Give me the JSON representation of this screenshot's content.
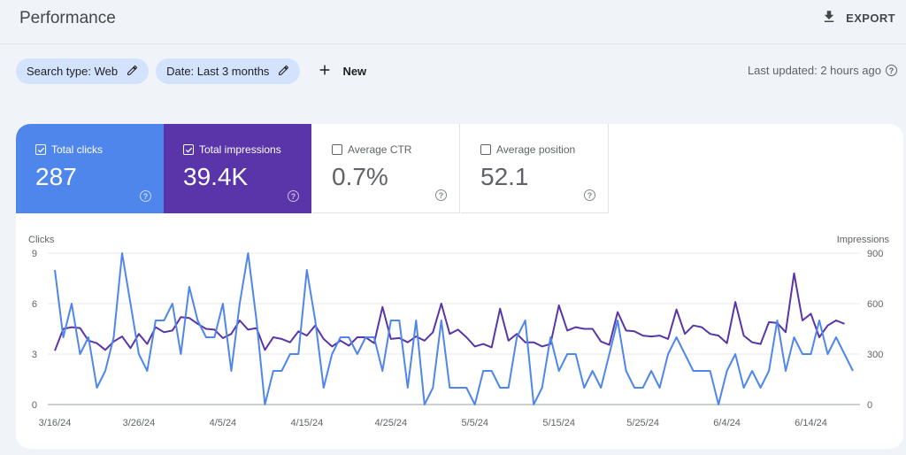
{
  "header": {
    "title": "Performance",
    "export_label": "EXPORT"
  },
  "filters": {
    "search_type": "Search type: Web",
    "date": "Date: Last 3 months",
    "new_label": "New"
  },
  "last_updated": "Last updated: 2 hours ago",
  "metrics": [
    {
      "label": "Total clicks",
      "value": "287",
      "checked": true,
      "color": "#4f86ec"
    },
    {
      "label": "Total impressions",
      "value": "39.4K",
      "checked": true,
      "color": "#5935a9"
    },
    {
      "label": "Average CTR",
      "value": "0.7%",
      "checked": false
    },
    {
      "label": "Average position",
      "value": "52.1",
      "checked": false
    }
  ],
  "chart_data": {
    "type": "line",
    "title": "",
    "ylabel_left": "Clicks",
    "ylabel_right": "Impressions",
    "y_left_ticks": [
      "0",
      "3",
      "6",
      "9"
    ],
    "y_right_ticks": [
      "0",
      "300",
      "600",
      "900"
    ],
    "ylim_left": [
      0,
      9
    ],
    "ylim_right": [
      0,
      900
    ],
    "x_tick_labels": [
      "3/16/24",
      "3/26/24",
      "4/5/24",
      "4/15/24",
      "4/25/24",
      "5/5/24",
      "5/15/24",
      "5/25/24",
      "6/4/24",
      "6/14/24"
    ],
    "x_start": "3/16/24",
    "x_end": "6/14/24",
    "grid": true,
    "series": [
      {
        "name": "Clicks",
        "axis": "left",
        "color": "#4f86ec",
        "values": [
          8,
          4,
          6,
          3,
          4,
          1,
          2,
          4,
          9,
          6,
          3,
          2,
          5,
          5,
          6,
          3,
          7,
          5,
          4,
          4,
          6,
          2,
          6,
          9,
          5,
          0,
          2,
          2,
          3,
          3,
          8,
          5,
          1,
          3,
          4,
          4,
          3,
          4,
          4,
          2,
          5,
          5,
          1,
          5,
          0,
          1,
          5,
          1,
          1,
          1,
          0,
          2,
          2,
          1,
          1,
          4,
          5,
          0,
          1,
          4,
          2,
          3,
          3,
          1,
          2,
          1,
          3,
          5,
          2,
          1,
          1,
          2,
          1,
          3,
          4,
          3,
          2,
          2,
          2,
          0,
          2,
          3,
          1,
          2,
          1,
          2,
          5,
          2,
          4,
          3,
          3,
          5,
          3,
          4,
          3,
          2
        ]
      },
      {
        "name": "Impressions",
        "axis": "right",
        "color": "#5935a9",
        "values": [
          320,
          450,
          460,
          455,
          380,
          365,
          325,
          375,
          405,
          335,
          420,
          360,
          460,
          430,
          440,
          520,
          515,
          480,
          450,
          445,
          395,
          420,
          500,
          445,
          455,
          325,
          400,
          390,
          370,
          435,
          410,
          470,
          390,
          345,
          380,
          350,
          400,
          400,
          365,
          580,
          390,
          395,
          370,
          405,
          380,
          430,
          600,
          420,
          445,
          400,
          345,
          360,
          340,
          570,
          380,
          420,
          370,
          370,
          345,
          360,
          590,
          440,
          460,
          450,
          450,
          375,
          355,
          550,
          440,
          435,
          410,
          405,
          410,
          390,
          565,
          420,
          470,
          460,
          420,
          410,
          365,
          610,
          410,
          370,
          360,
          490,
          485,
          430,
          780,
          500,
          540,
          400,
          470,
          500,
          480
        ]
      }
    ]
  }
}
